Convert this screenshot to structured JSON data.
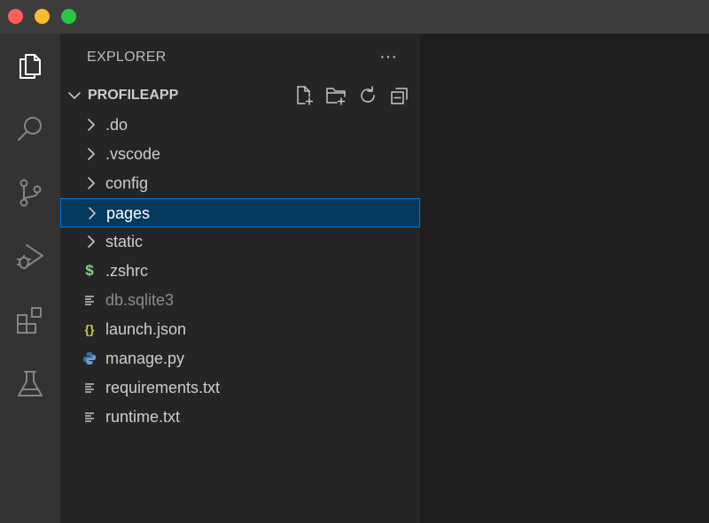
{
  "activity_bar": {
    "items": [
      {
        "icon": "files-icon",
        "active": true
      },
      {
        "icon": "search-icon",
        "active": false
      },
      {
        "icon": "source-control-icon",
        "active": false
      },
      {
        "icon": "run-debug-icon",
        "active": false
      },
      {
        "icon": "extensions-icon",
        "active": false
      },
      {
        "icon": "testing-icon",
        "active": false
      }
    ]
  },
  "sidebar": {
    "header": "EXPLORER",
    "more_label": "···",
    "section": {
      "title": "PROFILEAPP",
      "tools": [
        "new-file-icon",
        "new-folder-icon",
        "refresh-icon",
        "collapse-all-icon"
      ]
    },
    "tree": [
      {
        "label": ".do",
        "type": "folder"
      },
      {
        "label": ".vscode",
        "type": "folder"
      },
      {
        "label": "config",
        "type": "folder"
      },
      {
        "label": "pages",
        "type": "folder",
        "selected": true
      },
      {
        "label": "static",
        "type": "folder"
      },
      {
        "label": ".zshrc",
        "type": "shell",
        "icon_glyph": "$"
      },
      {
        "label": "db.sqlite3",
        "type": "text",
        "muted": true
      },
      {
        "label": "launch.json",
        "type": "json",
        "icon_glyph": "{}"
      },
      {
        "label": "manage.py",
        "type": "python"
      },
      {
        "label": "requirements.txt",
        "type": "text"
      },
      {
        "label": "runtime.txt",
        "type": "text"
      }
    ]
  },
  "colors": {
    "titlebar": "#3c3c3c",
    "activity_bar": "#333333",
    "sidebar": "#252526",
    "editor": "#1e1e1e",
    "selection": "#04395e",
    "selection_border": "#0078d4",
    "shell_icon": "#89d185",
    "json_icon": "#cbcb41",
    "python_icon": "#3572a5"
  }
}
